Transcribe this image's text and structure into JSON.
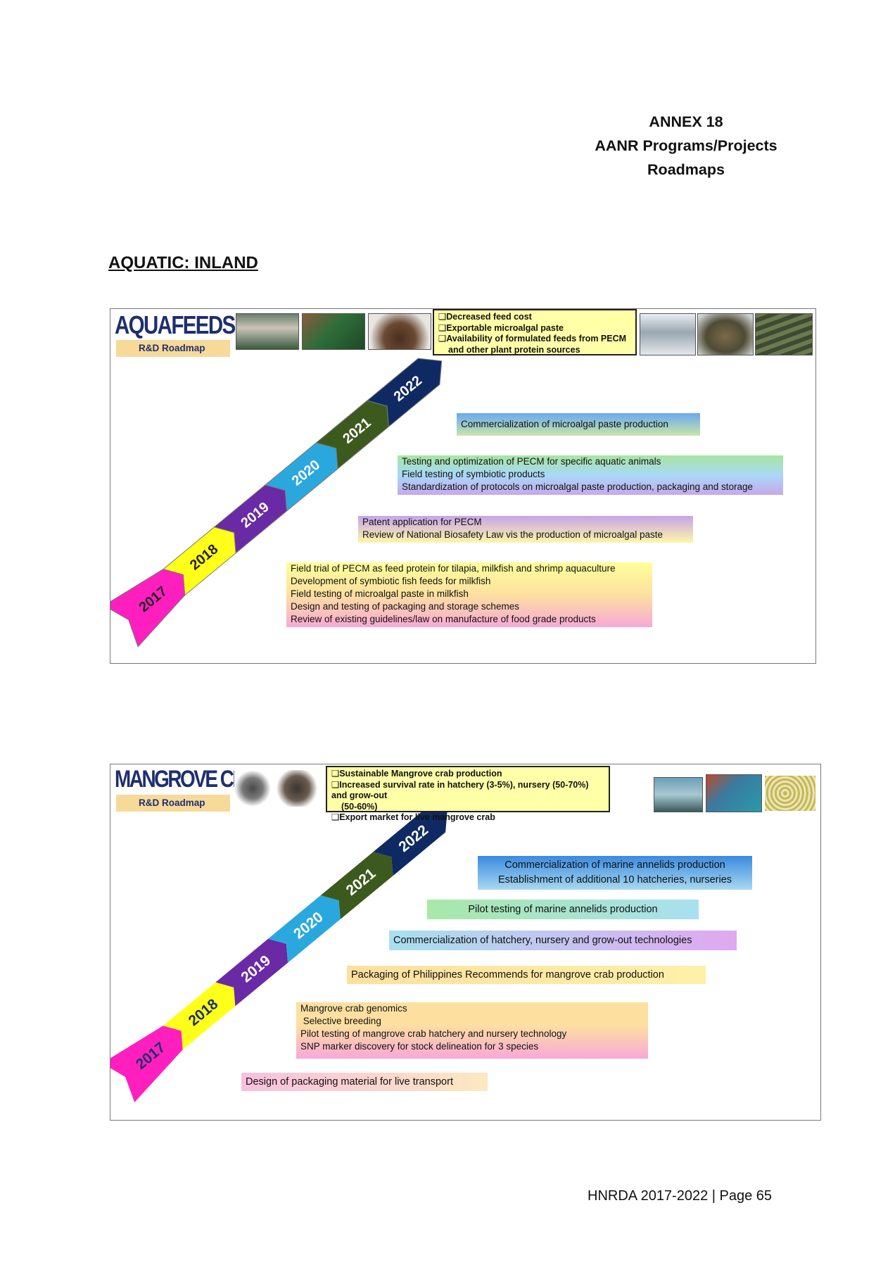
{
  "header": {
    "annex": "ANNEX 18",
    "title_line1": "AANR Programs/Projects",
    "title_line2": "Roadmaps"
  },
  "section_title": "AQUATIC:  INLAND",
  "roadmaps": [
    {
      "brand": "AQUAFEEDS",
      "subtitle": "R&D Roadmap",
      "years": [
        "2017",
        "2018",
        "2019",
        "2020",
        "2021",
        "2022"
      ],
      "goals": [
        "Decreased feed cost",
        "Exportable microalgal paste",
        "Availability of formulated feeds from PECM",
        "and other plant protein sources"
      ],
      "activities": [
        {
          "lines": [
            "Commercialization of microalgal paste production"
          ]
        },
        {
          "lines": [
            "Testing and optimization of PECM for specific aquatic animals",
            "Field testing of symbiotic products",
            "Standardization of protocols on microalgal paste production, packaging and storage"
          ]
        },
        {
          "lines": [
            "Patent application for PECM",
            "Review of National Biosafety Law vis the production of microalgal paste"
          ]
        },
        {
          "lines": [
            "Field trial of PECM as feed protein for tilapia, milkfish and shrimp aquaculture",
            "Development of symbiotic fish feeds for milkfish",
            "Field testing of microalgal paste in milkfish",
            "Design and testing of packaging and storage schemes",
            "Review of existing guidelines/law on manufacture of food grade products"
          ]
        }
      ]
    },
    {
      "brand": "MANGROVE CRAB",
      "subtitle": "R&D Roadmap",
      "years": [
        "2017",
        "2018",
        "2019",
        "2020",
        "2021",
        "2022"
      ],
      "goals": [
        "Sustainable Mangrove crab production",
        "Increased survival rate in hatchery (3-5%), nursery (50-70%) and grow-out",
        "(50-60%)",
        "Export market for live mangrove crab"
      ],
      "activities": [
        {
          "lines": [
            "Commercialization of marine annelids production",
            "Establishment of additional 10 hatcheries, nurseries"
          ]
        },
        {
          "lines": [
            "Pilot testing of marine annelids production"
          ]
        },
        {
          "lines": [
            "Commercialization of hatchery, nursery and grow-out technologies"
          ]
        },
        {
          "lines": [
            "Packaging of Philippines Recommends for mangrove crab production"
          ]
        },
        {
          "lines": [
            "Mangrove crab genomics",
            " Selective breeding",
            "Pilot testing of mangrove crab hatchery and nursery technology",
            "SNP marker discovery for stock delineation for 3 species"
          ]
        },
        {
          "lines": [
            "Design of packaging material for live transport"
          ]
        }
      ]
    }
  ],
  "colors": {
    "y2017": "#ff1fbf",
    "y2018": "#ffff19",
    "y2019": "#6a2aa5",
    "y2020": "#2aa8de",
    "y2021": "#3d5a1e",
    "y2022": "#0f2a63",
    "brand": "#1e2f6e"
  },
  "footer": "HNRDA 2017-2022  | Page  65"
}
